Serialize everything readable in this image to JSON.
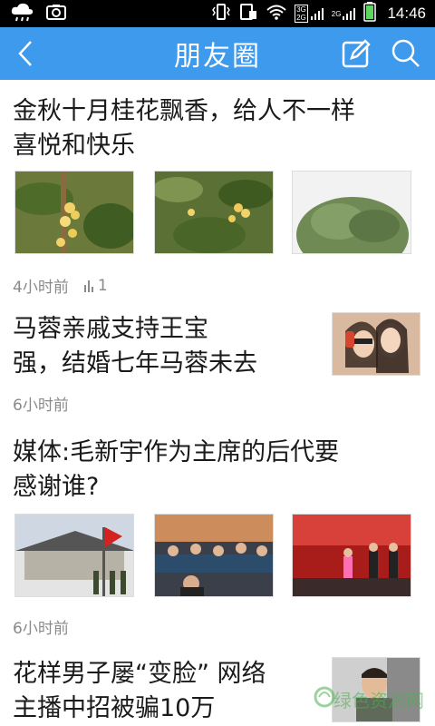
{
  "status_bar": {
    "time": "14:46",
    "network_top": "3G",
    "network_bottom": "2G",
    "network2": "2G",
    "icons": [
      "notification-cloud-icon",
      "screenshot-icon",
      "vibrate-icon",
      "sim-icon",
      "wifi-icon",
      "battery-icon"
    ]
  },
  "header": {
    "title": "朋友圈",
    "back_icon": "chevron-left-icon",
    "edit_icon": "compose-icon",
    "search_icon": "search-icon",
    "bar_color": "#3d9aec"
  },
  "feed": [
    {
      "title_line1": "金秋十月桂花飘香，给人不一样",
      "title_line2": "喜悦和快乐",
      "time": "4小时前",
      "views": "1",
      "thumbs": [
        "osmanthus-photo-1",
        "osmanthus-photo-2",
        "osmanthus-tree-photo"
      ]
    },
    {
      "title_line1": "马蓉亲戚支持王宝",
      "title_line2": "强，结婚七年马蓉未去",
      "time": "6小时前",
      "thumbs": [
        "two-women-selfie-photo"
      ]
    },
    {
      "title_line1": "媒体:毛新宇作为主席的后代要",
      "title_line2": "感谢谁?",
      "time": "6小时前",
      "thumbs": [
        "memorial-flag-photo",
        "meeting-photo",
        "stage-event-photo"
      ]
    },
    {
      "title_line1": "花样男子屡“变脸” 网络",
      "title_line2": "主播中招被骗10万",
      "thumbs": [
        "man-portrait-photo"
      ]
    }
  ],
  "watermark": {
    "text": "绿色资源网"
  }
}
